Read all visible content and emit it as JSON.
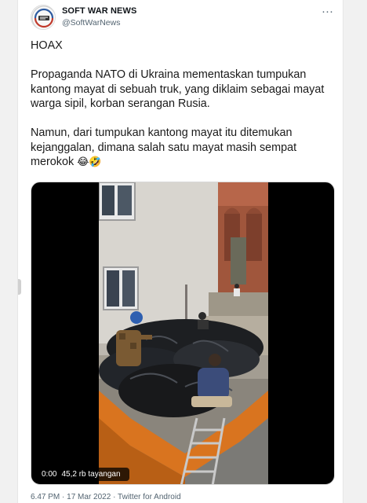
{
  "tweet": {
    "author_name": "SOFT WAR NEWS",
    "author_handle": "@SoftWarNews",
    "more_label": "···",
    "paragraphs": [
      "HOAX",
      "Propaganda NATO di Ukraina mementaskan tumpukan kantong mayat di sebuah truk, yang diklaim sebagai mayat warga sipil, korban serangan Rusia.",
      "Namun, dari tumpukan kantong mayat itu ditemukan kejanggalan, dimana salah satu mayat masih sempat merokok"
    ],
    "emojis": "😂🤣",
    "footer": {
      "time": "6.47 PM",
      "separator": "·",
      "date": "17 Mar 2022",
      "source": "Twitter for Android"
    }
  },
  "video": {
    "duration": "0:00",
    "views": "45,2 rb tayangan"
  },
  "colors": {
    "background": "#f1f1f1",
    "card": "#ffffff",
    "text": "#0f1419",
    "secondary": "#536471",
    "truck_orange": "#d9741f"
  }
}
